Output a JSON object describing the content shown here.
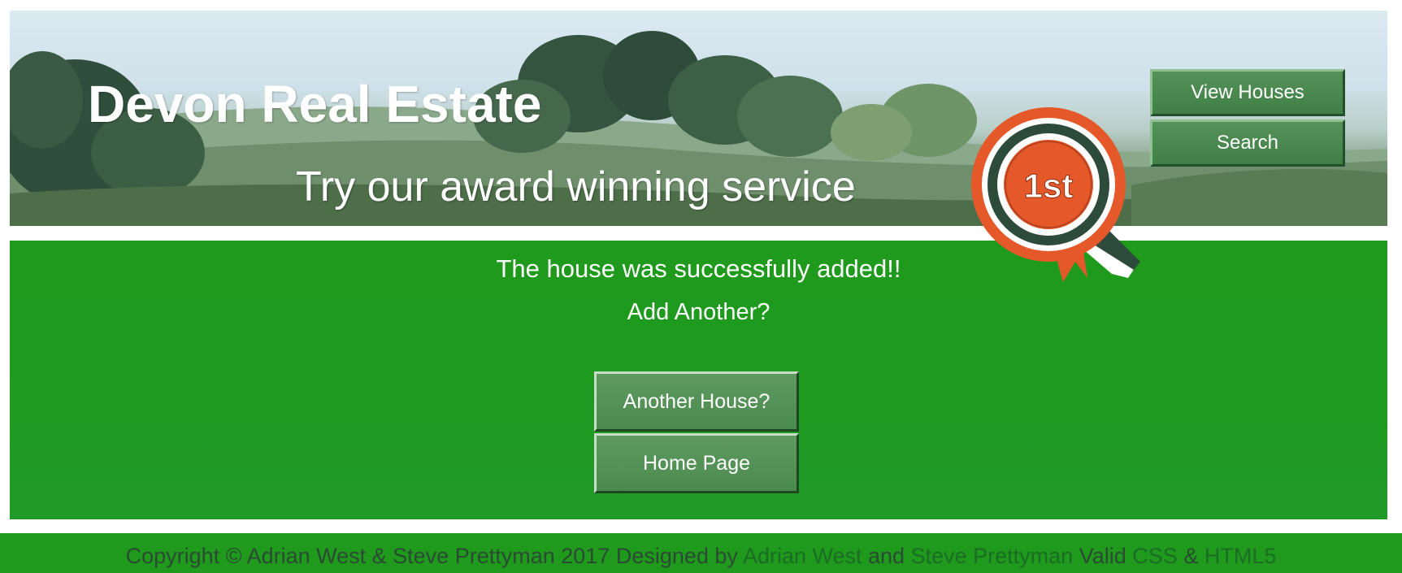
{
  "header": {
    "site_title": "Devon Real Estate",
    "tagline": "Try our award winning service",
    "nav": [
      {
        "label": "View Houses"
      },
      {
        "label": "Search"
      }
    ],
    "badge_text": "1st"
  },
  "main": {
    "success_message": "The house was successfully added!!",
    "prompt": "Add Another?",
    "buttons": {
      "another_house": "Another House?",
      "home_page": "Home Page"
    }
  },
  "footer": {
    "copyright": "Copyright © Adrian West & Steve Prettyman 2017 Designed by",
    "author1": "Adrian West",
    "and": "and",
    "author2": "Steve Prettyman",
    "valid": "Valid",
    "css_link": "CSS",
    "amp": "&",
    "html_link": "HTML5"
  },
  "colors": {
    "main_green": "#1f9a1c",
    "button_green": "#4b8a4f",
    "rosette_orange": "#e4582a"
  }
}
